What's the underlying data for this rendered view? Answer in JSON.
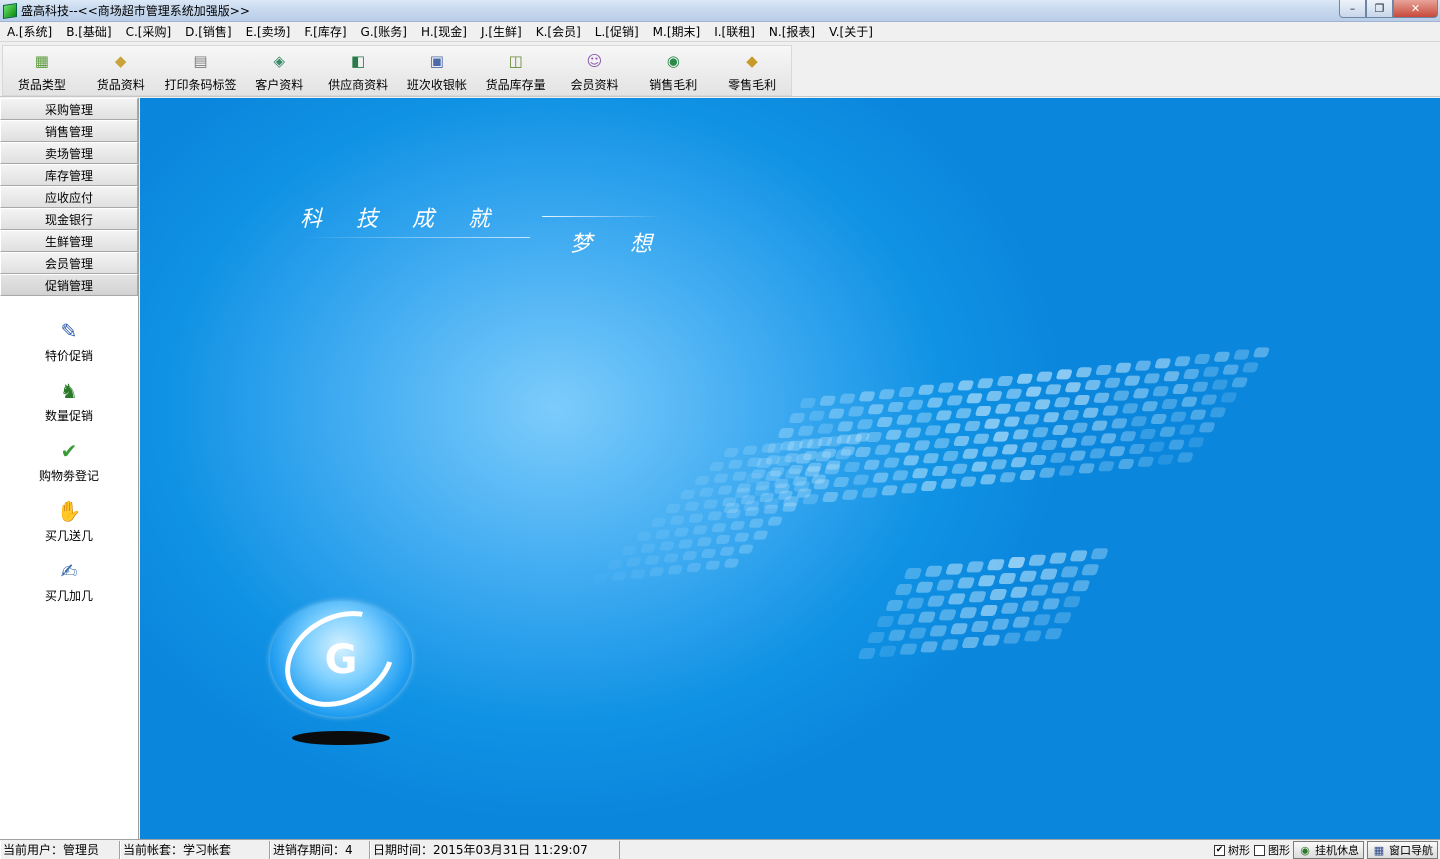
{
  "window": {
    "title": "盛高科技--<<商场超市管理系统加强版>>",
    "buttons": {
      "minimize": "–",
      "maximize": "❐",
      "close": "✕"
    }
  },
  "menu": [
    "A.[系统]",
    "B.[基础]",
    "C.[采购]",
    "D.[销售]",
    "E.[卖场]",
    "F.[库存]",
    "G.[账务]",
    "H.[现金]",
    "J.[生鲜]",
    "K.[会员]",
    "L.[促销]",
    "M.[期末]",
    "I.[联租]",
    "N.[报表]",
    "V.[关于]"
  ],
  "toolbar": [
    {
      "label": "货品类型",
      "icon": "goods-type-icon",
      "glyph": "▦",
      "color": "#5a9a3a"
    },
    {
      "label": "货品资料",
      "icon": "goods-info-icon",
      "glyph": "◆",
      "color": "#c8a23a"
    },
    {
      "label": "打印条码标签",
      "icon": "printer-icon",
      "glyph": "▤",
      "color": "#7a7a7a"
    },
    {
      "label": "客户资料",
      "icon": "customer-icon",
      "glyph": "◈",
      "color": "#3a8a6a"
    },
    {
      "label": "供应商资料",
      "icon": "supplier-icon",
      "glyph": "◧",
      "color": "#2a7a4a"
    },
    {
      "label": "班次收银帐",
      "icon": "cashier-icon",
      "glyph": "▣",
      "color": "#4a6aaa"
    },
    {
      "label": "货品库存量",
      "icon": "inventory-icon",
      "glyph": "◫",
      "color": "#6a8a3a"
    },
    {
      "label": "会员资料",
      "icon": "member-icon",
      "glyph": "☺",
      "color": "#8a5aaa"
    },
    {
      "label": "销售毛利",
      "icon": "sales-profit-icon",
      "glyph": "◉",
      "color": "#2a8a4a"
    },
    {
      "label": "零售毛利",
      "icon": "retail-profit-icon",
      "glyph": "◆",
      "color": "#c89a2a"
    }
  ],
  "sidebar": {
    "groups": [
      "采购管理",
      "销售管理",
      "卖场管理",
      "库存管理",
      "应收应付",
      "现金银行",
      "生鲜管理",
      "会员管理",
      "促销管理"
    ],
    "active_group": "促销管理",
    "items": [
      {
        "label": "特价促销",
        "icon": "special-offer-icon",
        "glyph": "✎",
        "color": "#2a5aaa"
      },
      {
        "label": "数量促销",
        "icon": "quantity-promo-icon",
        "glyph": "♞",
        "color": "#2a7a2a"
      },
      {
        "label": "购物劵登记",
        "icon": "coupon-icon",
        "glyph": "✔",
        "color": "#3a9a3a"
      },
      {
        "label": "买几送几",
        "icon": "buy-get-free-icon",
        "glyph": "✋",
        "color": "#c8901a"
      },
      {
        "label": "买几加几",
        "icon": "buy-add-icon",
        "glyph": "✍",
        "color": "#3a6aaa"
      }
    ]
  },
  "banner": {
    "slogan_left": "科技成就",
    "slogan_right": "梦想",
    "logo_letter": "G",
    "background": "#1092e4"
  },
  "status": {
    "user": "当前用户：管理员",
    "account": "当前帐套：学习帐套",
    "period": "进销存期间：4",
    "datetime": "日期时间：2015年03月31日 11:29:07",
    "tree_label": "树形",
    "tree_checked": true,
    "graph_label": "图形",
    "graph_checked": false,
    "lock_button": "挂机休息",
    "nav_button": "窗口导航"
  }
}
